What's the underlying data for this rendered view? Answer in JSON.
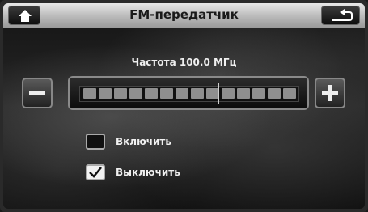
{
  "header": {
    "title": "FM-передатчик",
    "home_icon": "home-icon",
    "back_icon": "return-arrow-icon"
  },
  "frequency": {
    "label": "Частота 100.0 МГц"
  },
  "controls": {
    "minus_icon": "minus-icon",
    "plus_icon": "plus-icon"
  },
  "options": [
    {
      "label": "Включить",
      "checked": false
    },
    {
      "label": "Выключить",
      "checked": true
    }
  ]
}
